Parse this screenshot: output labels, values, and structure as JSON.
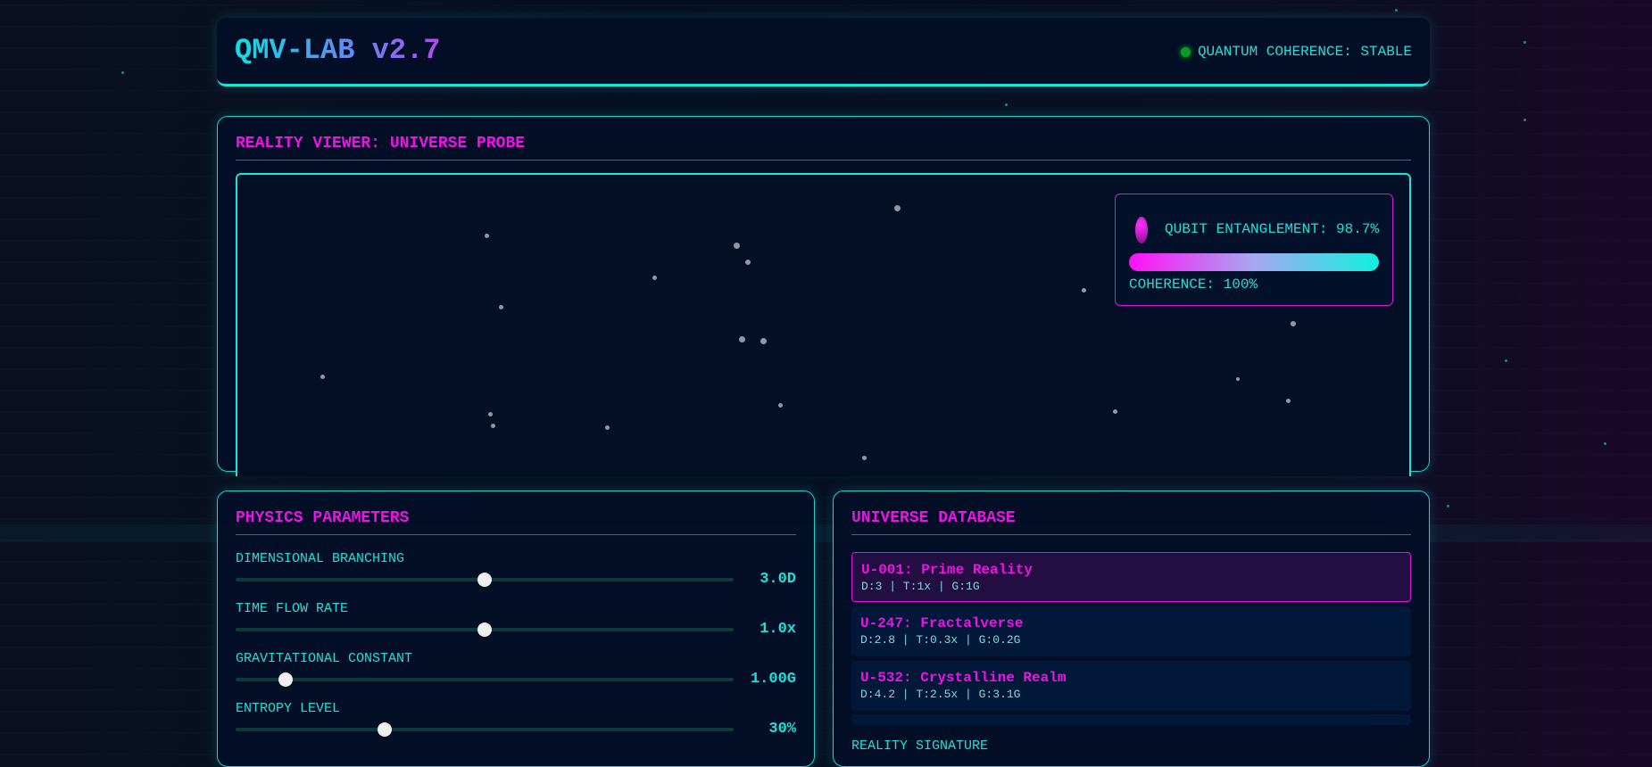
{
  "header": {
    "title": "QMV-LAB v2.7",
    "status": "QUANTUM COHERENCE: STABLE"
  },
  "viewer": {
    "title": "REALITY VIEWER: UNIVERSE PROBE",
    "entanglement": "QUBIT ENTANGLEMENT: 98.7%",
    "coherence": "COHERENCE: 100%",
    "coherence_fraction": 1.0
  },
  "physics": {
    "title": "PHYSICS PARAMETERS",
    "params": [
      {
        "label": "DIMENSIONAL BRANCHING",
        "value": "3.0D",
        "fraction": 0.5
      },
      {
        "label": "TIME FLOW RATE",
        "value": "1.0x",
        "fraction": 0.5
      },
      {
        "label": "GRAVITATIONAL CONSTANT",
        "value": "1.00G",
        "fraction": 0.1
      },
      {
        "label": "ENTROPY LEVEL",
        "value": "30%",
        "fraction": 0.3
      }
    ]
  },
  "database": {
    "title": "UNIVERSE DATABASE",
    "items": [
      {
        "name": "U-001: Prime Reality",
        "meta": "D:3 | T:1x | G:1G",
        "selected": true
      },
      {
        "name": "U-247: Fractalverse",
        "meta": "D:2.8 | T:0.3x | G:0.2G"
      },
      {
        "name": "U-532: Crystalline Realm",
        "meta": "D:4.2 | T:2.5x | G:3.1G"
      }
    ],
    "signature_label": "REALITY SIGNATURE"
  }
}
